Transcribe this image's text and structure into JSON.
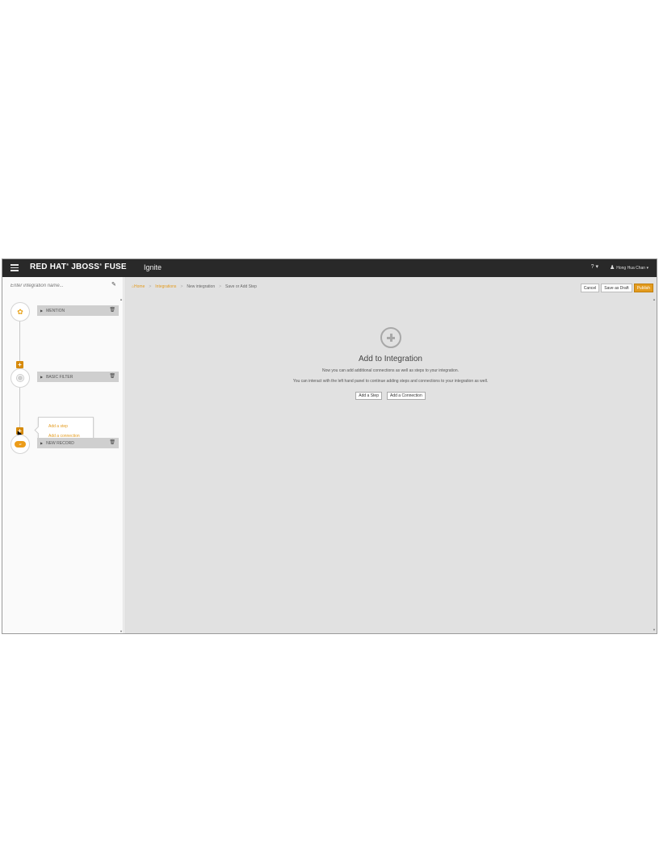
{
  "navbar": {
    "brand_main": "RED HAT",
    "brand_jboss": "JBOSS",
    "brand_fuse": "FUSE",
    "product": "Ignite",
    "help_label": "?",
    "user_name": "Hong Hua Chan"
  },
  "left_panel": {
    "name_placeholder": "Enter integration name...",
    "steps": [
      {
        "label": "MENTION",
        "icon": "twitter-icon"
      },
      {
        "label": "BASIC FILTER",
        "icon": "filter-icon"
      },
      {
        "label": "NEW RECORD",
        "icon": "salesforce-icon"
      }
    ],
    "salesforce_logo_text": "sf",
    "popover": {
      "add_step": "Add a step",
      "add_connection": "Add a connection"
    }
  },
  "breadcrumb": {
    "home": "Home",
    "integrations": "Integrations",
    "new_integration": "New integration",
    "current": "Save or Add Step"
  },
  "actions": {
    "cancel": "Cancel",
    "save_draft": "Save as Draft",
    "publish": "Publish"
  },
  "main": {
    "title": "Add to Integration",
    "description_1": "Now you can add additional connections as well as steps to your integration.",
    "description_2": "You can interact with the left hand panel to continue adding steps and connections to your integration as well.",
    "add_step_button": "Add a Step",
    "add_connection_button": "Add a Connection"
  },
  "colors": {
    "accent": "#e39b1e",
    "navbar": "#292929",
    "main_bg": "#e1e1e1"
  }
}
